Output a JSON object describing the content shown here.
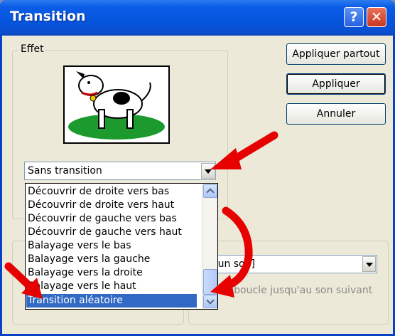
{
  "window": {
    "title": "Transition",
    "help_button": "?",
    "close_button": "✕"
  },
  "effect_group": {
    "label": "Effet",
    "selected_effect": "Sans transition"
  },
  "buttons": {
    "apply_all": "Appliquer partout",
    "apply": "Appliquer",
    "cancel": "Annuler"
  },
  "dropdown_list": {
    "items": [
      "Découvrir de droite vers bas",
      "Découvrir de droite vers haut",
      "Découvrir de gauche vers bas",
      "Découvrir de gauche vers haut",
      "Balayage vers le bas",
      "Balayage vers la gauche",
      "Balayage vers la droite",
      "Balayage vers le haut",
      "Transition aléatoire"
    ],
    "selected_index": 8
  },
  "sound_group": {
    "selected_sound": "ucun son]",
    "loop_checkbox_label": "En boucle jusqu'au son suivant"
  },
  "icons": [
    "help-icon",
    "close-icon",
    "chevron-down-icon",
    "chevron-up-icon",
    "red-arrow-annotation"
  ],
  "colors": {
    "titlebar": "#0654de",
    "selection": "#316ac5",
    "annotation_arrow": "#e60000",
    "dialog_bg": "#ece9d8"
  }
}
